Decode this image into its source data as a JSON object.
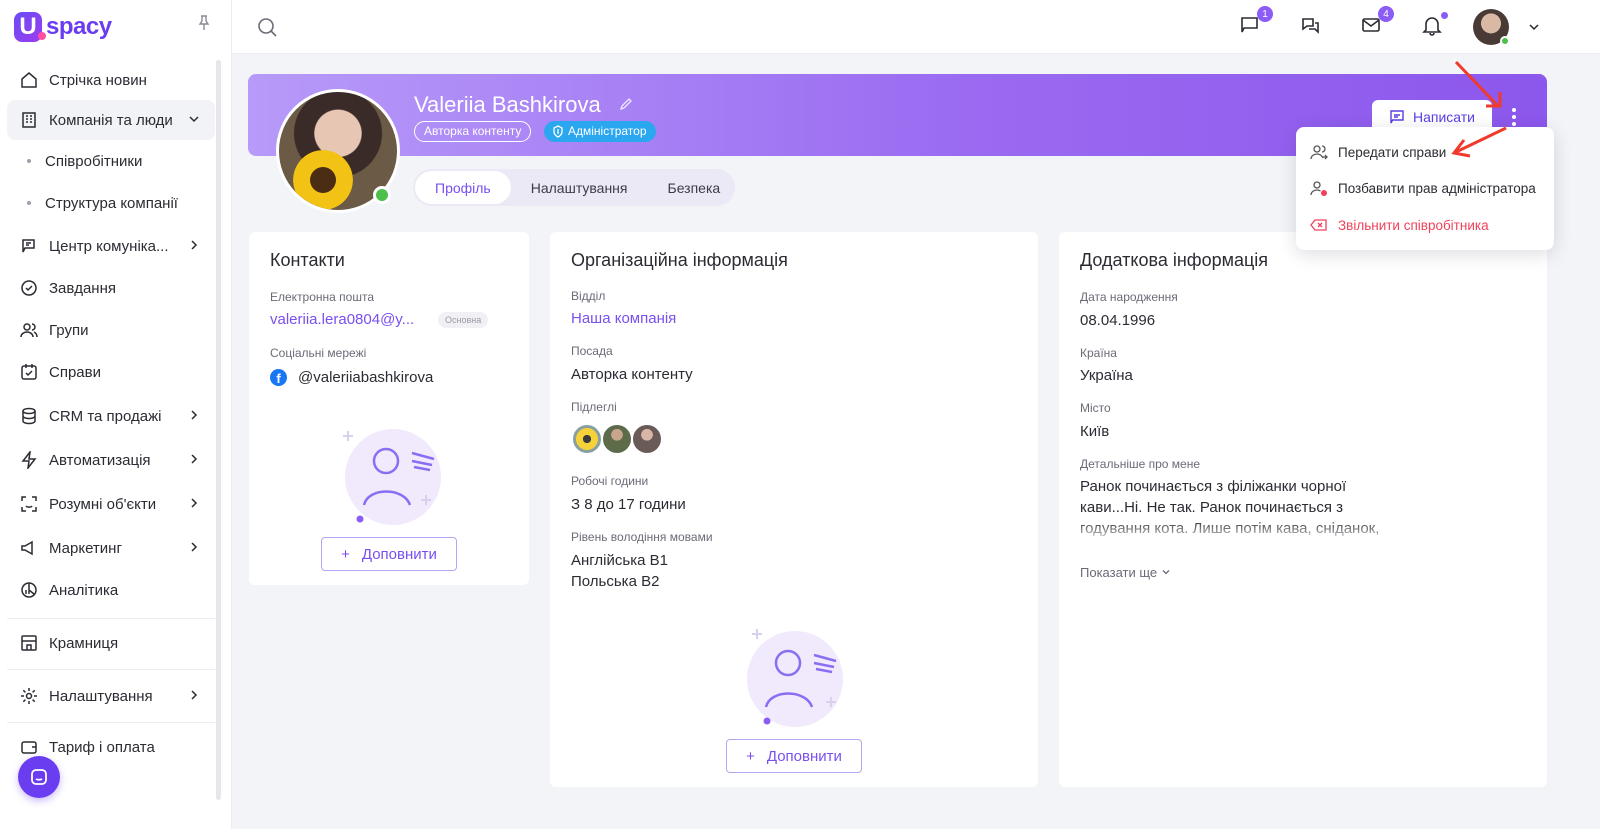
{
  "brand": {
    "logo_letter": "U",
    "logo_text": "spacy"
  },
  "sidebar": {
    "items": [
      {
        "label": "Стрічка новин",
        "icon": "home-icon"
      },
      {
        "label": "Компанія та люди",
        "icon": "building-icon",
        "expanded": true
      },
      {
        "label": "Співробітники",
        "sub": true
      },
      {
        "label": "Структура компанії",
        "sub": true
      },
      {
        "label": "Центр комуніка...",
        "icon": "communication-icon"
      },
      {
        "label": "Завдання",
        "icon": "check-circle-icon"
      },
      {
        "label": "Групи",
        "icon": "users-icon"
      },
      {
        "label": "Справи",
        "icon": "calendar-check-icon"
      },
      {
        "label": "CRM та продажі",
        "icon": "database-icon"
      },
      {
        "label": "Автоматизація",
        "icon": "lightning-icon"
      },
      {
        "label": "Розумні об'єкти",
        "icon": "scan-icon"
      },
      {
        "label": "Маркетинг",
        "icon": "megaphone-icon"
      },
      {
        "label": "Аналітика",
        "icon": "chart-pie-icon"
      },
      {
        "label": "Крамниця",
        "icon": "store-icon"
      },
      {
        "label": "Налаштування",
        "icon": "gear-icon"
      },
      {
        "label": "Тариф і оплата",
        "icon": "wallet-icon"
      }
    ]
  },
  "topbar": {
    "chat_badge": "1",
    "mail_badge": "4"
  },
  "profile": {
    "name": "Valeriia Bashkirova",
    "role_badge": "Авторка контенту",
    "admin_badge": "Адміністратор",
    "write_button": "Написати",
    "tabs": [
      "Профіль",
      "Налаштування",
      "Безпека"
    ],
    "active_tab": "Профіль"
  },
  "contacts": {
    "title": "Контакти",
    "email_label": "Електронна пошта",
    "email_value": "valeriia.lera0804@y...",
    "email_tag": "Основна",
    "social_label": "Соціальні мережі",
    "social_value": "@valeriiabashkirova",
    "fill_button": "Доповнити"
  },
  "org": {
    "title": "Організаційна інформація",
    "dept_label": "Відділ",
    "dept_value": "Наша компанія",
    "position_label": "Посада",
    "position_value": "Авторка контенту",
    "subordinates_label": "Підлеглі",
    "hours_label": "Робочі години",
    "hours_value": "З 8 до 17 години",
    "lang_label": "Рівень володіння мовами",
    "lang_values": [
      "Англійська B1",
      "Польська B2"
    ],
    "fill_button": "Доповнити"
  },
  "extra": {
    "title": "Додаткова інформація",
    "birth_label": "Дата народження",
    "birth_value": "08.04.1996",
    "country_label": "Країна",
    "country_value": "Україна",
    "city_label": "Місто",
    "city_value": "Київ",
    "about_label": "Детальніше про мене",
    "about_value": "Ранок починається з філіжанки чорної кави...Ні. Не так. Ранок починається з годування кота. Лише потім кава, сніданок, робота, відпочинок. Вечір. Знову час",
    "show_more": "Показати ще"
  },
  "dropdown": {
    "items": [
      "Передати справи",
      "Позбавити прав адміністратора",
      "Звільнити співробітника"
    ]
  },
  "colors": {
    "accent": "#7a4ff0",
    "danger": "#f0415a",
    "admin_badge": "#2ba7f0",
    "online": "#4cc04a"
  }
}
